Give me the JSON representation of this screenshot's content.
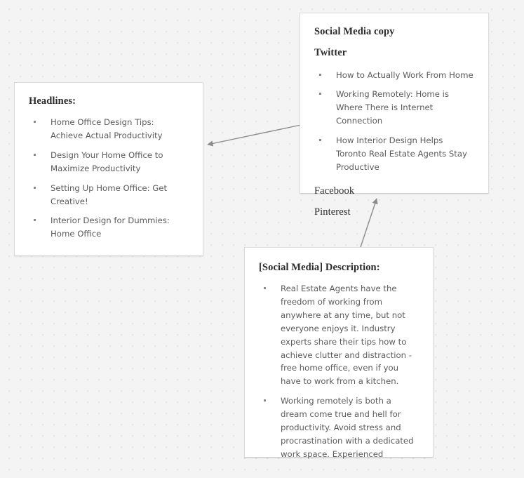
{
  "canvas": {
    "background_color": "#f4f4f4",
    "dot_color": "#e4e4e4",
    "card_background": "#ffffff",
    "card_border_color": "#dcdcdc",
    "heading_color": "#2b2b2b",
    "body_text_color": "#5b5b5b",
    "arrow_color": "#8c8c8c"
  },
  "cards": {
    "headlines": {
      "title": "Headlines:",
      "items": [
        "Home Office Design Tips: Achieve Actual Productivity",
        "Design Your Home Office to Maximize Productivity",
        "Setting Up Home Office: Get Creative!",
        "Interior Design for Dummies: Home Office"
      ]
    },
    "social_media": {
      "title": "Social Media copy",
      "twitter_label": "Twitter",
      "twitter_items": [
        "How to Actually Work From Home",
        "Working Remotely: Home is Where There is Internet Connection",
        "How Interior Design Helps Toronto Real Estate Agents Stay Productive"
      ],
      "facebook_label": "Facebook",
      "pinterest_label": "Pinterest"
    },
    "description": {
      "title": "[Social Media] Description:",
      "items": [
        "Real Estate Agents have the freedom of working from anywhere at any time, but not everyone enjoys it. Industry experts share their tips how to achieve clutter and distraction -free home office, even if you have to work from a kitchen.",
        "Working remotely is both a dream come true and hell for productivity. Avoid stress and procrastination with a dedicated work space. Experienced"
      ]
    }
  },
  "connectors": [
    {
      "name": "social-to-headlines",
      "from": "social_media",
      "to": "headlines",
      "direction": "left"
    },
    {
      "name": "description-to-social",
      "from": "description",
      "to": "social_media",
      "direction": "up"
    }
  ]
}
